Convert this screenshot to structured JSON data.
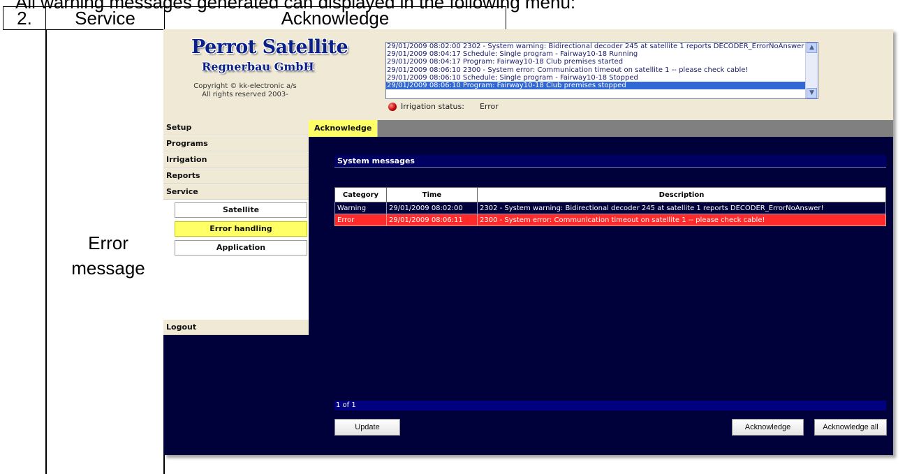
{
  "document": {
    "heading": "All warning messages generated can displayed in the following menu:",
    "step_number": "2.",
    "column_service": "Service",
    "column_title": "Acknowledge",
    "row_label_line1": "Error",
    "row_label_line2": "message"
  },
  "app": {
    "logo_line1": "Perrot Satellite",
    "logo_line2": "Regnerbau GmbH",
    "copyright_line1": "Copyright © kk-electronic a/s",
    "copyright_line2": "All rights reserved 2003-",
    "log_messages": [
      "29/01/2009 08:02:00 2302 - System warning: Bidirectional decoder 245 at satellite 1 reports DECODER_ErrorNoAnswer!",
      "29/01/2009 08:04:17 Schedule: Single program - Fairway10-18 Running",
      "29/01/2009 08:04:17 Program: Fairway10-18 Club premises started",
      "29/01/2009 08:06:10 2300 - System error: Communication timeout on satellite 1 -- please check cable!",
      "29/01/2009 08:06:10 Schedule: Single program - Fairway10-18 Stopped",
      "29/01/2009 08:06:10 Program: Fairway10-18 Club premises stopped"
    ],
    "status_label": "Irrigation status:",
    "status_value": "Error",
    "status_color": "#cc0000"
  },
  "sidebar": {
    "menu": [
      "Setup",
      "Programs",
      "Irrigation",
      "Reports",
      "Service"
    ],
    "sub_items": [
      "Satellite",
      "Error handling",
      "Application"
    ],
    "active_sub_item": "Error handling",
    "logout": "Logout"
  },
  "tabs": {
    "active": "Acknowledge"
  },
  "main": {
    "section_title": "System messages",
    "table": {
      "headers": [
        "Category",
        "Time",
        "Description"
      ],
      "rows": [
        [
          "Warning",
          "29/01/2009 08:02:00",
          "2302 - System warning: Bidirectional decoder 245 at satellite 1 reports DECODER_ErrorNoAnswer!"
        ],
        [
          "Error",
          "29/01/2009 08:06:11",
          "2300 - System error: Communication timeout on satellite 1 -- please check cable!"
        ]
      ]
    },
    "pager": "1 of 1",
    "buttons": {
      "update": "Update",
      "acknowledge": "Acknowledge",
      "acknowledge_all": "Acknowledge all"
    }
  },
  "colors": {
    "app_bg": "#00003a",
    "header_bg": "#efe9d6",
    "active_yellow": "#ffff66",
    "error_row": "#ff2b2b",
    "logo_blue": "#0b1f88"
  }
}
